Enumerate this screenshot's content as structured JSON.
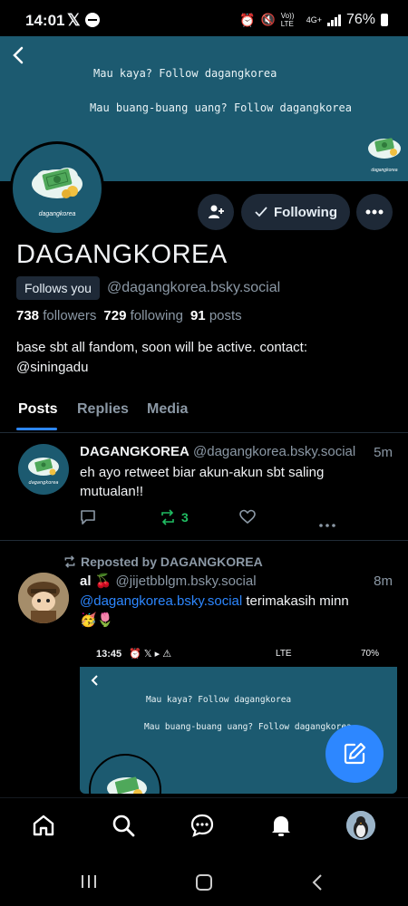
{
  "status_bar": {
    "time": "14:01",
    "battery": "76%",
    "network": "4G+",
    "volte": "Vo)) LTE"
  },
  "banner": {
    "line1": "Mau kaya? Follow dagangkorea",
    "line2": "Mau buang-buang uang? Follow dagangkorea",
    "logo_text": "dagangkorea"
  },
  "profile": {
    "name": "DAGANGKOREA",
    "follows_you": "Follows you",
    "handle": "@dagangkorea.bsky.social",
    "followers_count": "738",
    "followers_label": "followers",
    "following_count": "729",
    "following_label": "following",
    "posts_count": "91",
    "posts_label": "posts",
    "bio_line1": "base sbt all fandom, soon will be active. contact:",
    "bio_line2": "@siningadu",
    "following_button": "Following"
  },
  "tabs": [
    {
      "label": "Posts",
      "active": true
    },
    {
      "label": "Replies",
      "active": false
    },
    {
      "label": "Media",
      "active": false
    }
  ],
  "posts": [
    {
      "author": "DAGANGKOREA",
      "handle": "@dagangkorea.bsky.social",
      "time": "5m",
      "text_line1": "eh ayo retweet biar akun-akun sbt saling",
      "text_line2": "mutualan!!",
      "reposts": "3"
    },
    {
      "repost_label": "Reposted by DAGANGKOREA",
      "author": "al 🍒",
      "handle": "@jijetbblgm.bsky.social",
      "time": "8m",
      "mention": "@dagangkorea.bsky.social",
      "text": " terimakasih minn",
      "emoji": "🥳🌷"
    }
  ],
  "embed": {
    "time": "13:45",
    "battery": "70%",
    "network": "LTE",
    "line1": "Mau kaya? Follow dagangkorea",
    "line2": "Mau buang-buang uang? Follow dagangkorea"
  },
  "colors": {
    "accent": "#2d87ff",
    "banner": "#1c5a70",
    "repost_green": "#20bc62",
    "muted": "#8b98a5"
  }
}
